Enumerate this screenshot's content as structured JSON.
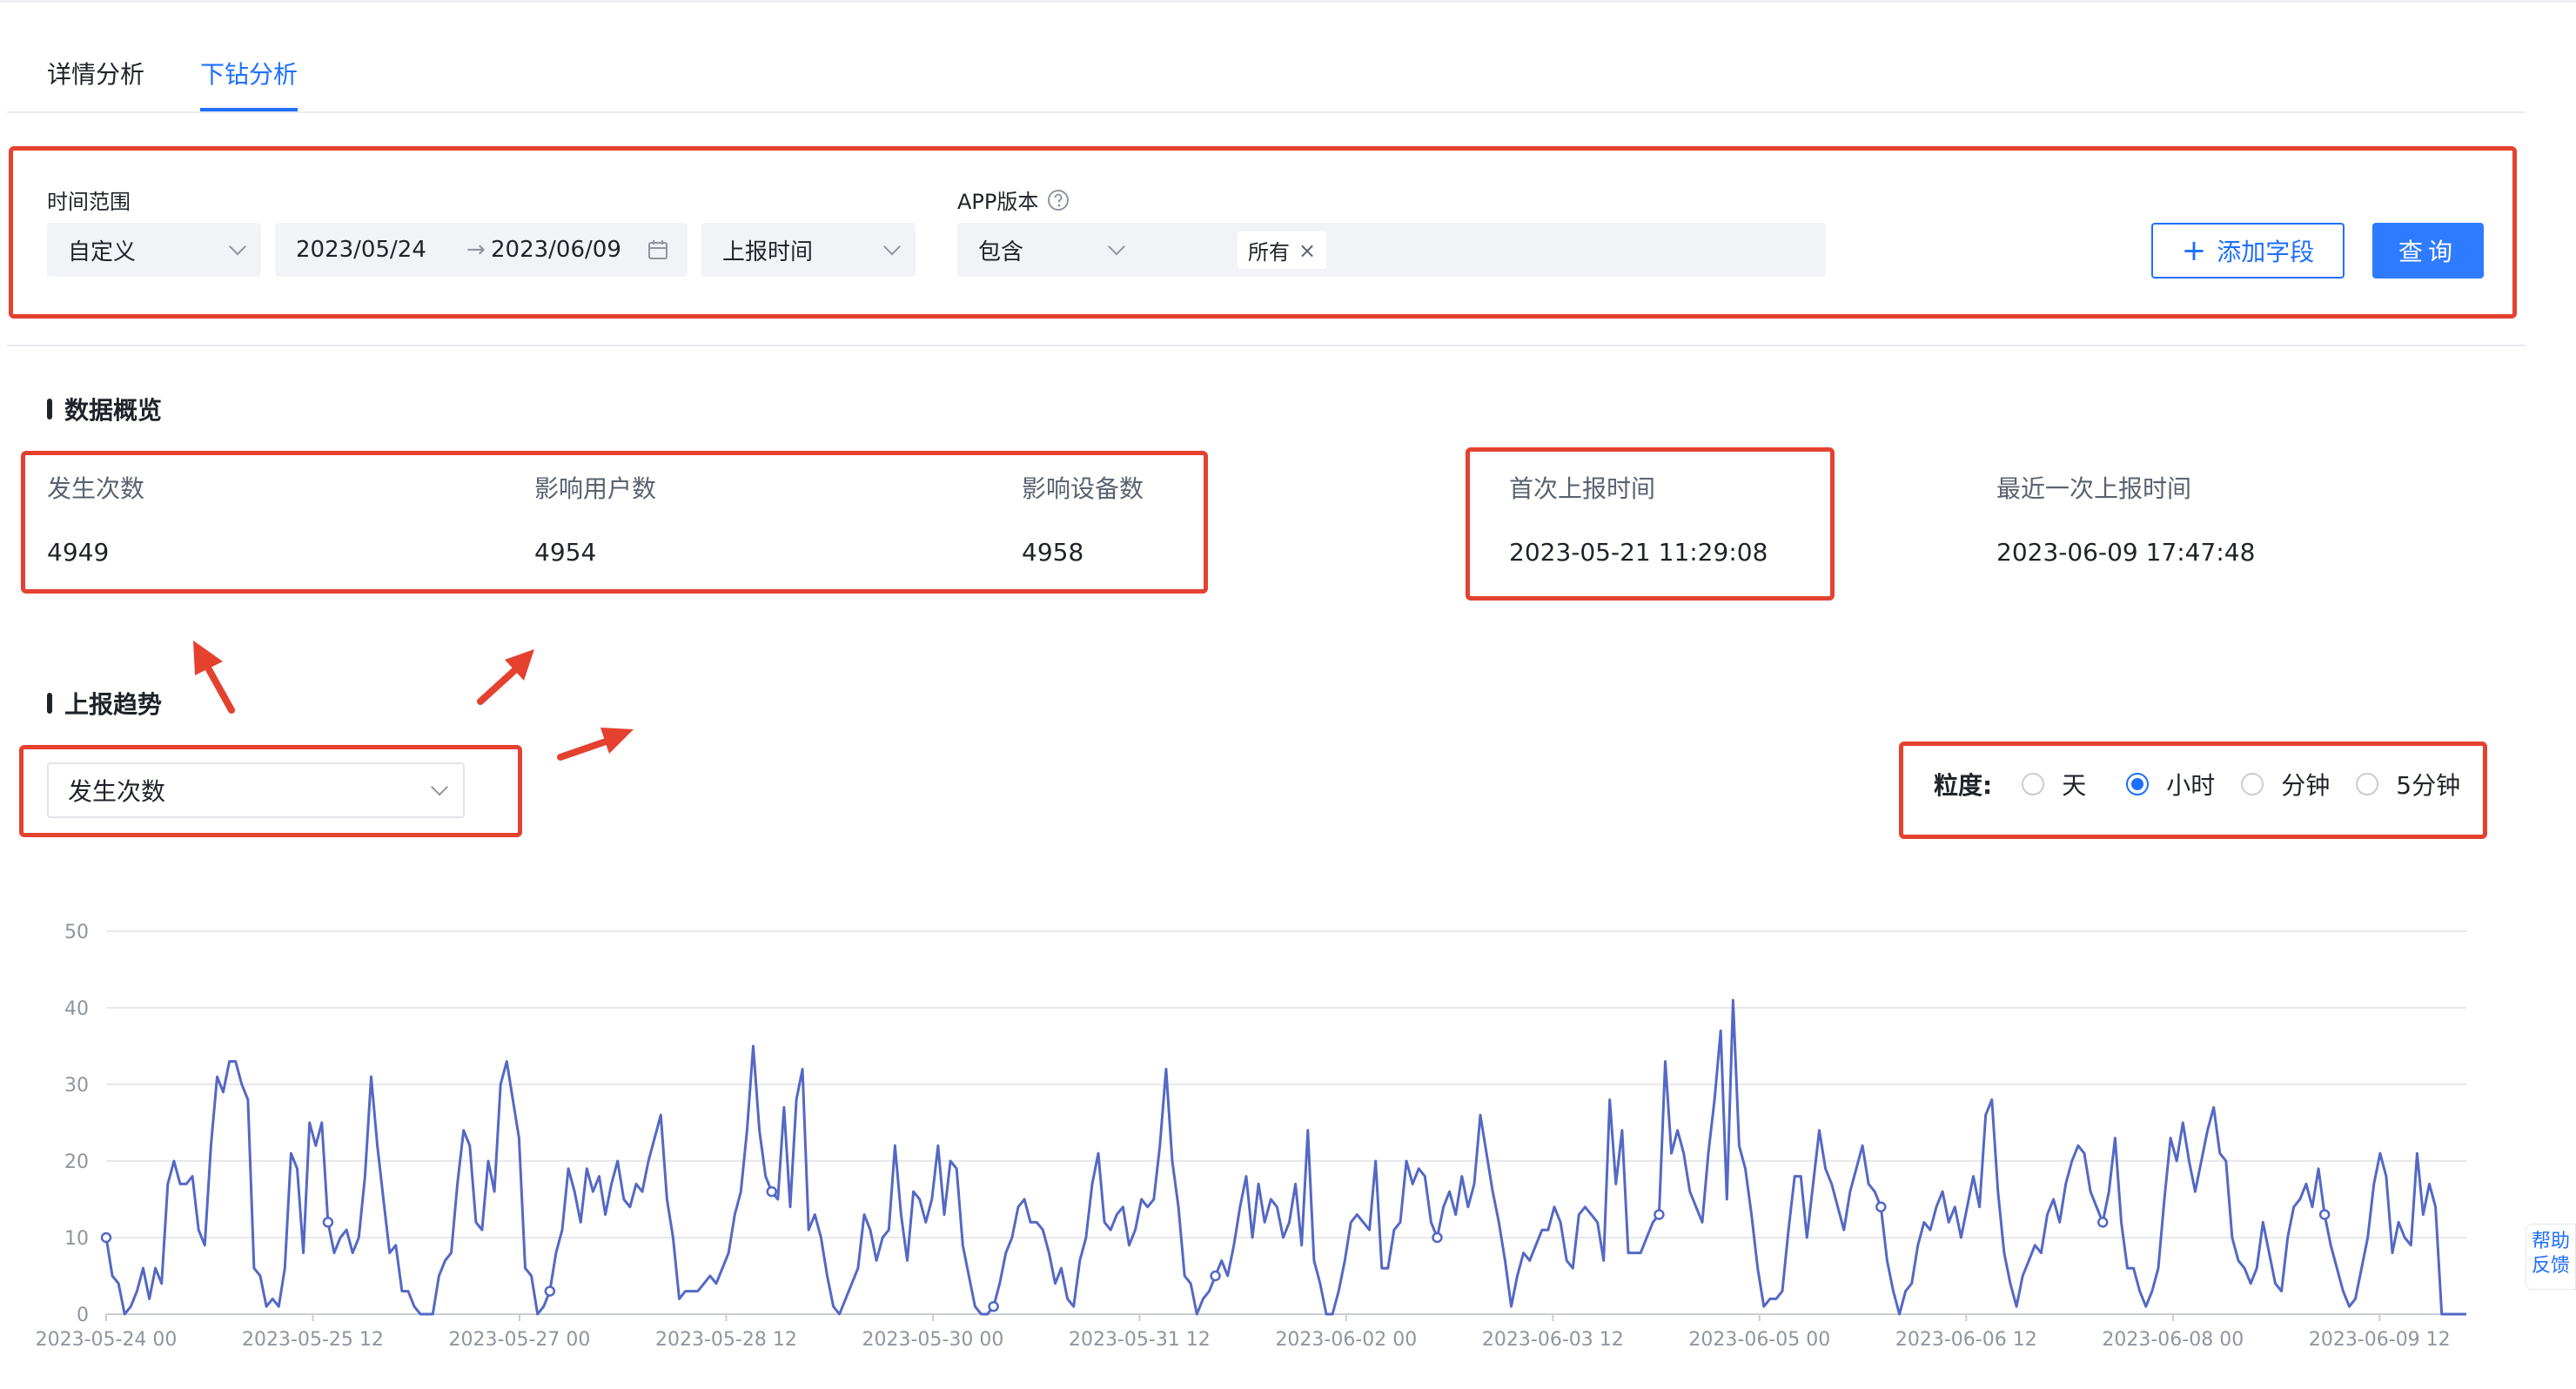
{
  "tabs": [
    {
      "label": "详情分析",
      "active": false
    },
    {
      "label": "下钻分析",
      "active": true
    }
  ],
  "filters": {
    "time_range_label": "时间范围",
    "range_mode": "自定义",
    "date_start": "2023/05/24",
    "date_arrow": "→",
    "date_end": "2023/06/09",
    "time_field": "上报时间",
    "app_version_label": "APP版本",
    "version_operator": "包含",
    "version_tag": "所有",
    "add_field_label": "添加字段",
    "query_label": "查询"
  },
  "overview": {
    "title": "数据概览",
    "stats": [
      {
        "label": "发生次数",
        "value": "4949"
      },
      {
        "label": "影响用户数",
        "value": "4954"
      },
      {
        "label": "影响设备数",
        "value": "4958"
      },
      {
        "label": "首次上报时间",
        "value": "2023-05-21 11:29:08"
      },
      {
        "label": "最近一次上报时间",
        "value": "2023-06-09 17:47:48"
      }
    ]
  },
  "trend": {
    "title": "上报趋势",
    "metric_select": "发生次数",
    "granularity_label": "粒度:",
    "granularity_options": [
      {
        "label": "天",
        "checked": false
      },
      {
        "label": "小时",
        "checked": true
      },
      {
        "label": "分钟",
        "checked": false
      },
      {
        "label": "5分钟",
        "checked": false
      }
    ]
  },
  "help_float": {
    "line1": "帮助",
    "line2": "反馈"
  },
  "colors": {
    "accent": "#1e6fff",
    "highlight_box": "#e5412f",
    "series": "#5468c4"
  },
  "chart_data": {
    "type": "line",
    "ylim": [
      0,
      50
    ],
    "yticks": [
      0,
      10,
      20,
      30,
      40,
      50
    ],
    "xticks": [
      "2023-05-24 00",
      "2023-05-25 12",
      "2023-05-27 00",
      "2023-05-28 12",
      "2023-05-30 00",
      "2023-05-31 12",
      "2023-06-02 00",
      "2023-06-03 12",
      "2023-06-05 00",
      "2023-06-06 12",
      "2023-06-08 00",
      "2023-06-09 12"
    ],
    "grid": true,
    "series": [
      {
        "values": [
          10,
          5,
          4,
          0,
          1,
          3,
          6,
          2,
          6,
          4,
          17,
          20,
          17,
          17,
          18,
          11,
          9,
          22,
          31,
          29,
          33,
          33,
          30,
          28,
          6,
          5,
          1,
          2,
          1,
          6,
          21,
          19,
          8,
          25,
          22,
          25,
          12,
          8,
          10,
          11,
          8,
          10,
          18,
          31,
          22,
          15,
          8,
          9,
          3,
          3,
          1,
          0,
          0,
          0,
          5,
          7,
          8,
          17,
          24,
          22,
          12,
          11,
          20,
          16,
          30,
          33,
          28,
          23,
          6,
          5,
          0,
          1,
          3,
          8,
          11,
          19,
          16,
          12,
          19,
          16,
          18,
          13,
          17,
          20,
          15,
          14,
          17,
          16,
          20,
          23,
          26,
          15,
          10,
          2,
          3,
          3,
          3,
          4,
          5,
          4,
          6,
          8,
          13,
          16,
          24,
          35,
          24,
          18,
          16,
          15,
          27,
          14,
          28,
          32,
          11,
          13,
          10,
          5,
          1,
          0,
          2,
          4,
          6,
          13,
          11,
          7,
          10,
          11,
          22,
          13,
          7,
          16,
          15,
          12,
          15,
          22,
          13,
          20,
          19,
          9,
          5,
          1,
          0,
          0,
          1,
          4,
          8,
          10,
          14,
          15,
          12,
          12,
          11,
          8,
          4,
          6,
          2,
          1,
          7,
          10,
          17,
          21,
          12,
          11,
          13,
          14,
          9,
          11,
          15,
          14,
          15,
          22,
          32,
          20,
          14,
          5,
          4,
          0,
          2,
          3,
          5,
          7,
          5,
          9,
          14,
          18,
          10,
          17,
          12,
          15,
          14,
          10,
          12,
          17,
          9,
          24,
          7,
          4,
          0,
          0,
          3,
          7,
          12,
          13,
          12,
          11,
          20,
          6,
          6,
          11,
          12,
          20,
          17,
          19,
          18,
          12,
          10,
          14,
          16,
          13,
          18,
          14,
          17,
          26,
          21,
          16,
          12,
          7,
          1,
          5,
          8,
          7,
          9,
          11,
          11,
          14,
          12,
          7,
          6,
          13,
          14,
          13,
          12,
          7,
          28,
          17,
          24,
          8,
          8,
          8,
          10,
          12,
          13,
          33,
          21,
          24,
          21,
          16,
          14,
          12,
          21,
          28,
          37,
          15,
          41,
          22,
          19,
          13,
          6,
          1,
          2,
          2,
          3,
          11,
          18,
          18,
          10,
          17,
          24,
          19,
          17,
          14,
          11,
          16,
          19,
          22,
          17,
          16,
          14,
          7,
          3,
          0,
          3,
          4,
          9,
          12,
          11,
          14,
          16,
          12,
          14,
          10,
          14,
          18,
          14,
          26,
          28,
          16,
          8,
          4,
          1,
          5,
          7,
          9,
          8,
          13,
          15,
          12,
          17,
          20,
          22,
          21,
          16,
          14,
          12,
          16,
          23,
          12,
          6,
          6,
          3,
          1,
          3,
          6,
          15,
          23,
          20,
          25,
          20,
          16,
          20,
          24,
          27,
          21,
          20,
          10,
          7,
          6,
          4,
          6,
          12,
          8,
          4,
          3,
          10,
          14,
          15,
          17,
          14,
          19,
          13,
          9,
          6,
          3,
          1,
          2,
          6,
          10,
          17,
          21,
          18,
          8,
          12,
          10,
          9,
          21,
          13,
          17,
          14,
          0,
          0,
          0,
          0,
          0
        ]
      }
    ]
  }
}
